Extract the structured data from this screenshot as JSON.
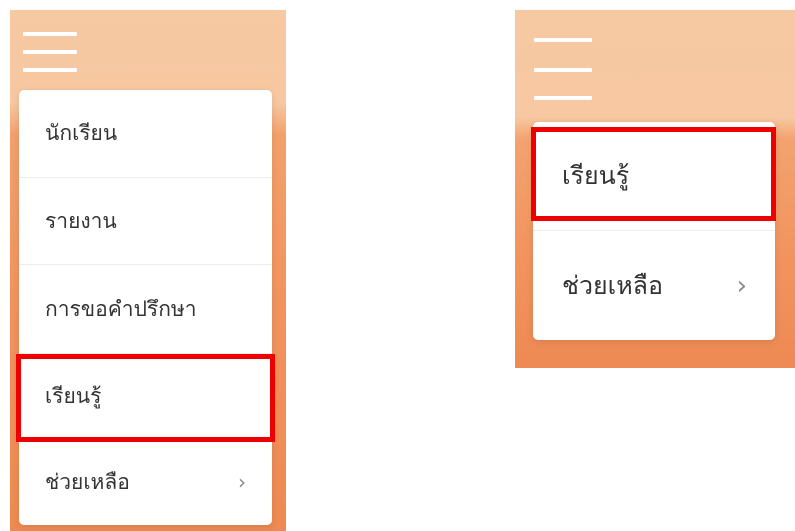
{
  "left_menu": {
    "items": [
      {
        "label": "นักเรียน",
        "has_submenu": false
      },
      {
        "label": "รายงาน",
        "has_submenu": false
      },
      {
        "label": "การขอคำปรึกษา",
        "has_submenu": false
      },
      {
        "label": "เรียนรู้",
        "has_submenu": false,
        "highlighted": true
      },
      {
        "label": "ช่วยเหลือ",
        "has_submenu": true
      }
    ]
  },
  "right_menu": {
    "items": [
      {
        "label": "เรียนรู้",
        "has_submenu": false,
        "highlighted": true
      },
      {
        "label": "ช่วยเหลือ",
        "has_submenu": true
      }
    ]
  },
  "icons": {
    "chevron": "›",
    "hamburger": "hamburger-menu-icon"
  },
  "colors": {
    "highlight": "#ee0000",
    "header": "#f6c9a2",
    "body": "#f2925c"
  }
}
